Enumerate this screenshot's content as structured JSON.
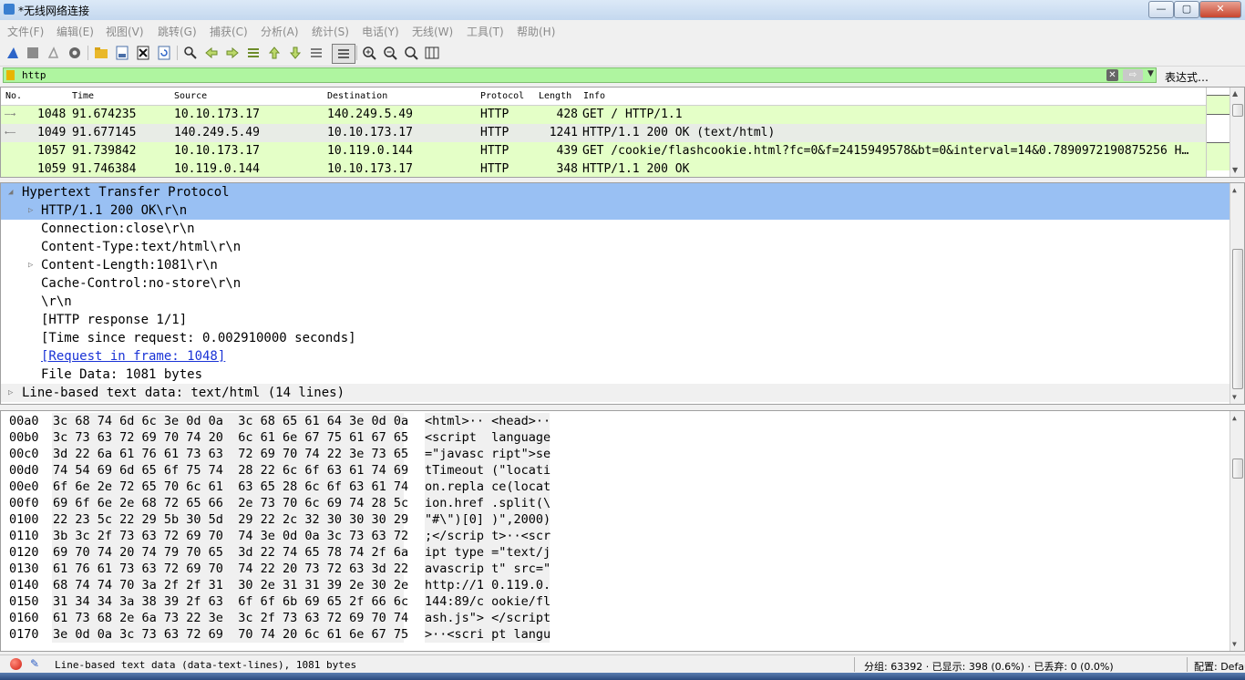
{
  "window": {
    "title": "*无线网络连接",
    "min_label": "—",
    "max_label": "▢",
    "close_label": "✕"
  },
  "menu": [
    "文件(F)",
    "编辑(E)",
    "视图(V)",
    "跳转(G)",
    "捕获(C)",
    "分析(A)",
    "统计(S)",
    "电话(Y)",
    "无线(W)",
    "工具(T)",
    "帮助(H)"
  ],
  "toolbar_icons": [
    "shark-fin-start-icon",
    "stop-icon",
    "restart-icon",
    "options-gear-icon",
    "open-folder-icon",
    "save-icon",
    "close-file-icon",
    "reload-icon",
    "find-icon",
    "back-arrow-icon",
    "forward-arrow-icon",
    "goto-packet-icon",
    "first-packet-icon",
    "last-packet-icon",
    "autoscroll-icon",
    "colorize-icon",
    "zoom-in-icon",
    "zoom-out-icon",
    "zoom-reset-icon",
    "resize-columns-icon"
  ],
  "filter": {
    "value": "http",
    "expression_label": "表达式…",
    "clear_label": "✕",
    "apply_label": "⇨",
    "dropdown_label": "▼"
  },
  "packet_list": {
    "columns": [
      "No.",
      "Time",
      "Source",
      "Destination",
      "Protocol",
      "Length",
      "Info"
    ],
    "rows": [
      {
        "no": "1048",
        "time": "91.674235",
        "src": "10.10.173.17",
        "dst": "140.249.5.49",
        "proto": "HTTP",
        "len": "428",
        "info": "GET / HTTP/1.1",
        "marker": "—→"
      },
      {
        "no": "1049",
        "time": "91.677145",
        "src": "140.249.5.49",
        "dst": "10.10.173.17",
        "proto": "HTTP",
        "len": "1241",
        "info": "HTTP/1.1 200 OK  (text/html)",
        "marker": "←—"
      },
      {
        "no": "1057",
        "time": "91.739842",
        "src": "10.10.173.17",
        "dst": "10.119.0.144",
        "proto": "HTTP",
        "len": "439",
        "info": "GET /cookie/flashcookie.html?fc=0&f=2415949578&bt=0&interval=14&0.7890972190875256 H…",
        "marker": ""
      },
      {
        "no": "1059",
        "time": "91.746384",
        "src": "10.119.0.144",
        "dst": "10.10.173.17",
        "proto": "HTTP",
        "len": "348",
        "info": "HTTP/1.1 200 OK",
        "marker": ""
      }
    ]
  },
  "detail": [
    "Hypertext Transfer Protocol",
    "HTTP/1.1 200 OK\\r\\n",
    "Connection:close\\r\\n",
    "Content-Type:text/html\\r\\n",
    "Content-Length:1081\\r\\n",
    "Cache-Control:no-store\\r\\n",
    "\\r\\n",
    "[HTTP response 1/1]",
    "[Time since request: 0.002910000 seconds]",
    "[Request in frame: 1048]",
    "File Data: 1081 bytes",
    "Line-based text data: text/html (14 lines)"
  ],
  "bytes": [
    {
      "off": "00a0",
      "hex": "3c 68 74 6d 6c 3e 0d 0a  3c 68 65 61 64 3e 0d 0a",
      "ascii": "<html>·· <head>··"
    },
    {
      "off": "00b0",
      "hex": "3c 73 63 72 69 70 74 20  6c 61 6e 67 75 61 67 65",
      "ascii": "<script  language"
    },
    {
      "off": "00c0",
      "hex": "3d 22 6a 61 76 61 73 63  72 69 70 74 22 3e 73 65",
      "ascii": "=\"javasc ript\">se"
    },
    {
      "off": "00d0",
      "hex": "74 54 69 6d 65 6f 75 74  28 22 6c 6f 63 61 74 69",
      "ascii": "tTimeout (\"locati"
    },
    {
      "off": "00e0",
      "hex": "6f 6e 2e 72 65 70 6c 61  63 65 28 6c 6f 63 61 74",
      "ascii": "on.repla ce(locat"
    },
    {
      "off": "00f0",
      "hex": "69 6f 6e 2e 68 72 65 66  2e 73 70 6c 69 74 28 5c",
      "ascii": "ion.href .split(\\"
    },
    {
      "off": "0100",
      "hex": "22 23 5c 22 29 5b 30 5d  29 22 2c 32 30 30 30 29",
      "ascii": "\"#\\\")[0] )\",2000)"
    },
    {
      "off": "0110",
      "hex": "3b 3c 2f 73 63 72 69 70  74 3e 0d 0a 3c 73 63 72",
      "ascii": ";</scrip t>··<scr"
    },
    {
      "off": "0120",
      "hex": "69 70 74 20 74 79 70 65  3d 22 74 65 78 74 2f 6a",
      "ascii": "ipt type =\"text/j"
    },
    {
      "off": "0130",
      "hex": "61 76 61 73 63 72 69 70  74 22 20 73 72 63 3d 22",
      "ascii": "avascrip t\" src=\""
    },
    {
      "off": "0140",
      "hex": "68 74 74 70 3a 2f 2f 31  30 2e 31 31 39 2e 30 2e",
      "ascii": "http://1 0.119.0."
    },
    {
      "off": "0150",
      "hex": "31 34 34 3a 38 39 2f 63  6f 6f 6b 69 65 2f 66 6c",
      "ascii": "144:89/c ookie/fl"
    },
    {
      "off": "0160",
      "hex": "61 73 68 2e 6a 73 22 3e  3c 2f 73 63 72 69 70 74",
      "ascii": "ash.js\"> </script"
    },
    {
      "off": "0170",
      "hex": "3e 0d 0a 3c 73 63 72 69  70 74 20 6c 61 6e 67 75",
      "ascii": ">··<scri pt langu"
    }
  ],
  "status": {
    "field": "Line-based text data (data-text-lines), 1081 bytes",
    "packets": "分组: 63392 · 已显示: 398 (0.6%) · 已丢弃: 0 (0.0%)",
    "profile": "配置: Default"
  }
}
